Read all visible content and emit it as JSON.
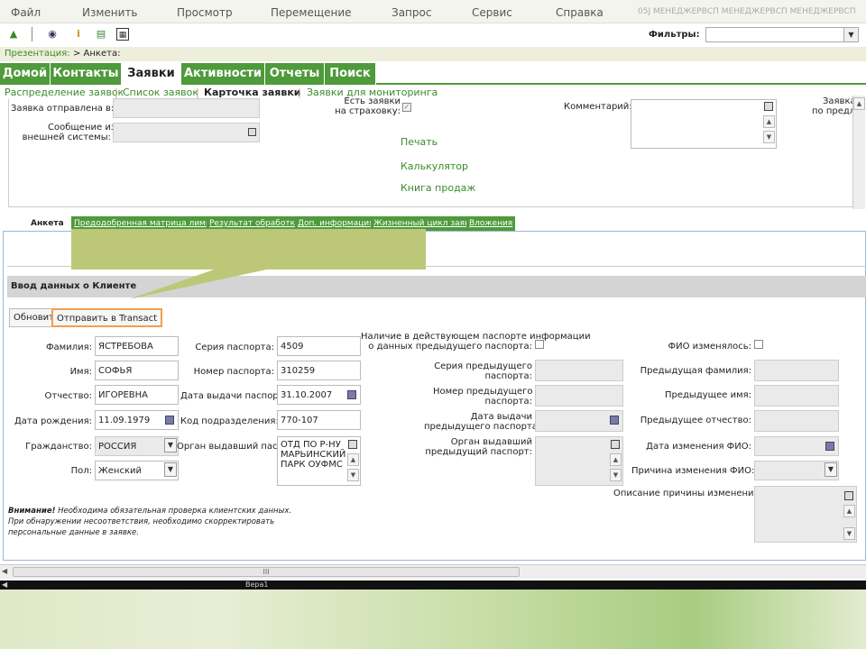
{
  "menu": {
    "items": [
      "Файл",
      "Изменить",
      "Просмотр",
      "Перемещение",
      "Запрос",
      "Сервис",
      "Справка"
    ],
    "user": "05J МЕНЕДЖЕРВСП МЕНЕДЖЕРВСП МЕНЕДЖЕРВСП"
  },
  "toolbar": {
    "filters_label": "Фильтры:",
    "filters_value": "",
    "icons": [
      "hierarchy-icon",
      "binoculars-icon",
      "info-icon",
      "document-icon",
      "calculator-icon"
    ]
  },
  "breadcrumb": {
    "root": "Презентация:",
    "current": "> Анкета:"
  },
  "nav": {
    "tabs": [
      "Домой",
      "Контакты",
      "Заявки",
      "Активности",
      "Отчеты",
      "Поиск"
    ],
    "active": "Заявки"
  },
  "subnav": {
    "items": [
      "Распределение заявок",
      "Список заявок",
      "Карточка заявки",
      "Заявки для мониторинга"
    ],
    "active": "Карточка заявки"
  },
  "top_form": {
    "sent_to_label": "Заявка отправлена в:",
    "sent_to_value": "",
    "ext_msg_label_1": "Сообщение из",
    "ext_msg_label_2": "внешней системы:",
    "ext_msg_value": "",
    "insurance_label_1": "Есть заявки",
    "insurance_label_2": "на страховку:",
    "comment_label": "Комментарий:",
    "comment_value": "",
    "right_label_1": "Заявка",
    "right_label_2": "по предл",
    "links": [
      "Печать",
      "Калькулятор",
      "Книга продаж"
    ]
  },
  "inner_tabs": {
    "items": [
      "Анкета",
      "Предодобренная матрица лимитов",
      "Результат обработки",
      "Доп. информация",
      "Жизненный цикл заявки",
      "Вложения"
    ],
    "active": "Анкета"
  },
  "section": {
    "title": "Ввод данных о Клиенте",
    "btn_refresh": "Обновить",
    "btn_send": "Отправить в Transact"
  },
  "client": {
    "lastname_label": "Фамилия:",
    "lastname": "ЯСТРЕБОВА",
    "firstname_label": "Имя:",
    "firstname": "СОФЬЯ",
    "patronymic_label": "Отчество:",
    "patronymic": "ИГОРЕВНА",
    "birth_label": "Дата рождения:",
    "birth": "11.09.1979",
    "citizenship_label": "Гражданство:",
    "citizenship": "РОССИЯ",
    "gender_label": "Пол:",
    "gender": "Женский"
  },
  "passport": {
    "series_label": "Серия паспорта:",
    "series": "4509",
    "number_label": "Номер паспорта:",
    "number": "310259",
    "issue_date_label": "Дата выдачи паспорта:",
    "issue_date": "31.10.2007",
    "dept_code_label": "Код подразделения:",
    "dept_code": "770-107",
    "issuer_label": "Орган выдавший паспорт:",
    "issuer_lines": [
      "ОТД ПО Р-НУ",
      "МАРЬИНСКИЙ",
      "ПАРК ОУФМС"
    ]
  },
  "prev_passport": {
    "has_info_label_1": "Наличие в действующем паспорте информации",
    "has_info_label_2": "о данных предыдущего паспорта:",
    "series_label_1": "Серия предыдущего",
    "series_label_2": "паспорта:",
    "number_label_1": "Номер предыдущего",
    "number_label_2": "паспорта:",
    "date_label_1": "Дата выдачи",
    "date_label_2": "предыдущего паспорта:",
    "issuer_label_1": "Орган выдавший",
    "issuer_label_2": "предыдущий паспорт:"
  },
  "fio_change": {
    "changed_label": "ФИО изменялось:",
    "prev_lastname_label": "Предыдущая фамилия:",
    "prev_firstname_label": "Предыдущее имя:",
    "prev_patronymic_label": "Предыдущее отчество:",
    "change_date_label": "Дата изменения ФИО:",
    "reason_label": "Причина изменения ФИО:",
    "reason_desc_label": "Описание причины изменения ФИО:"
  },
  "warning": {
    "bold": "Внимание!",
    "line1": " Необходима обязательная проверка клиентских данных.",
    "line2": "При обнаружении несоответствия, необходимо скорректировать",
    "line3": "персональные данные в заявке."
  },
  "bottom": {
    "hscroll_grip": "III",
    "taskbar_text": "Вера1"
  },
  "colors": {
    "nav_green": "#4f9a3b",
    "link_green": "#3a8a2a",
    "callout": "#bcc878",
    "focus_orange": "#f0a050"
  }
}
